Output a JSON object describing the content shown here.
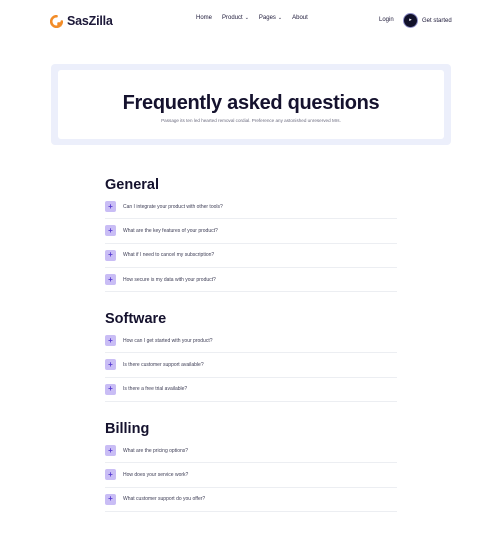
{
  "brand": {
    "name": "SasZilla",
    "accent": "#f28c28",
    "icon": "brand-logo-icon"
  },
  "nav": {
    "items": [
      {
        "label": "Home",
        "dropdown": false
      },
      {
        "label": "Product",
        "dropdown": true
      },
      {
        "label": "Pages",
        "dropdown": true
      },
      {
        "label": "About",
        "dropdown": false
      }
    ],
    "login": "Login",
    "cta": "Get started",
    "cta_icon": "arrow-right-icon"
  },
  "hero": {
    "title": "Frequently asked questions",
    "subtitle": "Passage its ten led hearted removal cordial. Preference any astonished unreserved Mrs."
  },
  "faq": {
    "sections": [
      {
        "title": "General",
        "questions": [
          "Can I integrate your product with other tools?",
          "What are the key features of your product?",
          "What if I need to cancel my subscription?",
          "How secure is my data with your product?"
        ]
      },
      {
        "title": "Software",
        "questions": [
          "How can I get started with your product?",
          "Is there customer support available?",
          "Is there a free trial available?"
        ]
      },
      {
        "title": "Billing",
        "questions": [
          "What are the pricing options?",
          "How does your service work?",
          "What customer support do you offer?"
        ]
      }
    ]
  },
  "colors": {
    "plus_bg": "#c9bdf5",
    "plus_fg": "#5b3fd1",
    "hero_bg": "#eceffb",
    "heading": "#15122e"
  }
}
